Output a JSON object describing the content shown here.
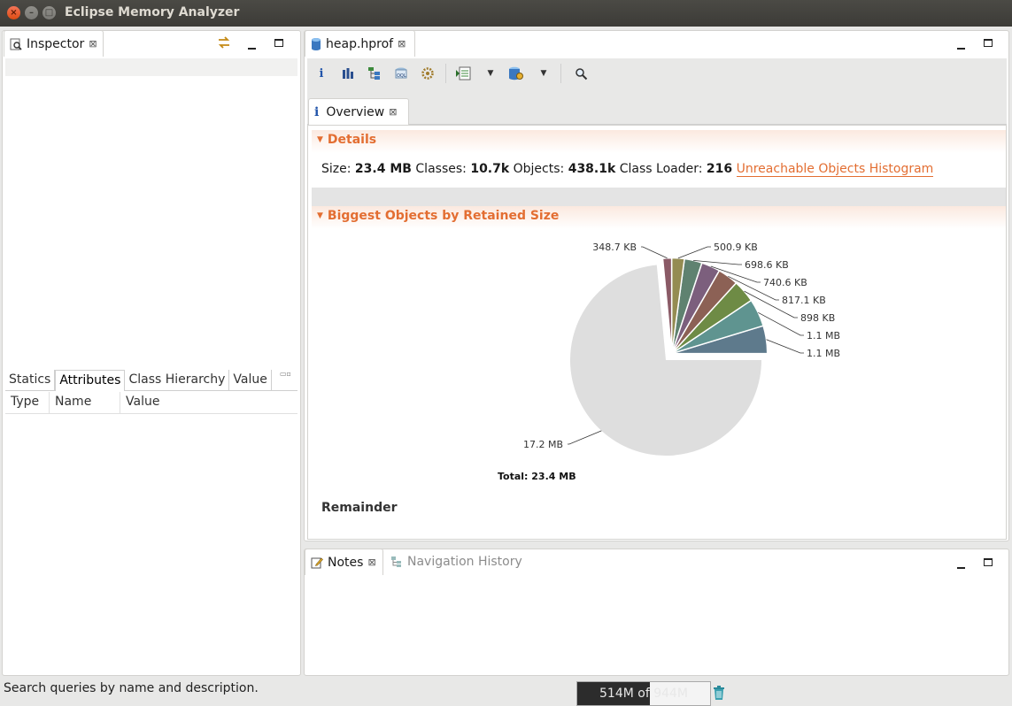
{
  "window": {
    "title": "Eclipse Memory Analyzer"
  },
  "inspector": {
    "tab_label": "Inspector",
    "subtabs": [
      "Statics",
      "Attributes",
      "Class Hierarchy",
      "Value"
    ],
    "columns": [
      "Type",
      "Name",
      "Value"
    ]
  },
  "editor": {
    "tab_label": "heap.hprof",
    "inner_tab_label": "Overview",
    "toolbar_icons": [
      "info-icon",
      "histogram-icon",
      "dominator-tree-icon",
      "oql-icon",
      "thread-overview-icon",
      "reports-icon",
      "dropdown-arrow-icon",
      "query-browser-icon",
      "dropdown-arrow-icon",
      "search-icon"
    ]
  },
  "details": {
    "header": "Details",
    "size_label": "Size:",
    "size_value": "23.4 MB",
    "classes_label": "Classes:",
    "classes_value": "10.7k",
    "objects_label": "Objects:",
    "objects_value": "438.1k",
    "loader_label": "Class Loader:",
    "loader_value": "216",
    "link_label": "Unreachable Objects Histogram"
  },
  "biggest": {
    "header": "Biggest Objects by Retained Size",
    "footer": "Remainder"
  },
  "chart_data": {
    "type": "pie",
    "total_label": "Total: 23.4 MB",
    "slices": [
      {
        "label": "1.1 MB",
        "value": 1.1,
        "color": "#5e7a8c"
      },
      {
        "label": "1.1 MB",
        "value": 1.1,
        "color": "#5f9490"
      },
      {
        "label": "898 KB",
        "value": 0.898,
        "color": "#6e8b45"
      },
      {
        "label": "817.1 KB",
        "value": 0.817,
        "color": "#8c6155"
      },
      {
        "label": "740.6 KB",
        "value": 0.741,
        "color": "#7c5f7d"
      },
      {
        "label": "698.6 KB",
        "value": 0.699,
        "color": "#5f8270"
      },
      {
        "label": "500.9 KB",
        "value": 0.501,
        "color": "#948c52"
      },
      {
        "label": "348.7 KB",
        "value": 0.349,
        "color": "#8a5a66"
      },
      {
        "label": "17.2 MB",
        "value": 17.2,
        "color": "#dedede"
      }
    ]
  },
  "notes": {
    "tab_label": "Notes",
    "nav_tab_label": "Navigation History"
  },
  "status": {
    "hint": "Search queries by name and description.",
    "heap_used_mb": 514,
    "heap_total_mb": 944,
    "heap_label": "514M of 944M"
  }
}
